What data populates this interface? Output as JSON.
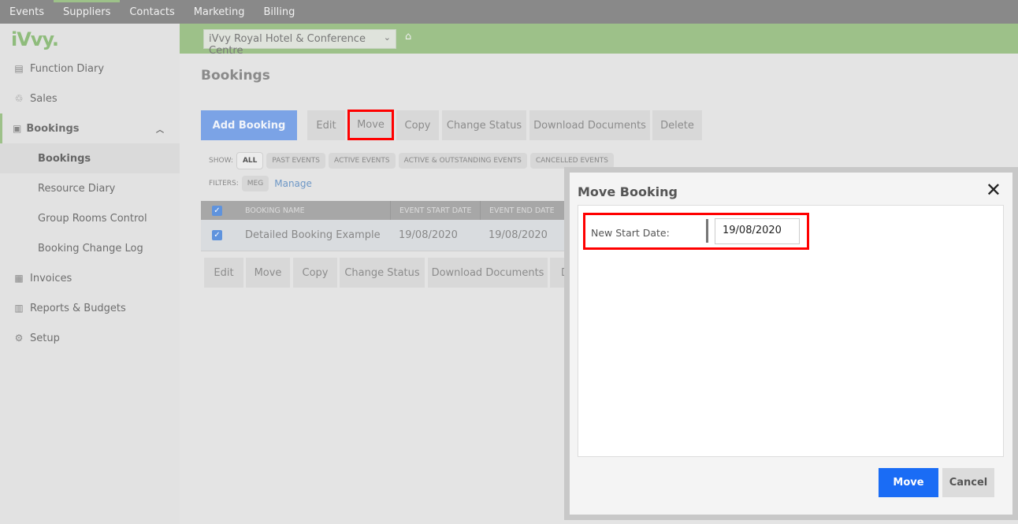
{
  "topnav": [
    "Events",
    "Suppliers",
    "Contacts",
    "Marketing",
    "Billing"
  ],
  "logo": "iVvy.",
  "sidebar": {
    "items": [
      {
        "icon": "calendar-icon",
        "label": "Function Diary"
      },
      {
        "icon": "sales-icon",
        "label": "Sales"
      },
      {
        "icon": "briefcase-icon",
        "label": "Bookings"
      },
      {
        "label": "Bookings"
      },
      {
        "label": "Resource Diary"
      },
      {
        "label": "Group Rooms Control"
      },
      {
        "label": "Booking Change Log"
      },
      {
        "icon": "calculator-icon",
        "label": "Invoices"
      },
      {
        "icon": "chart-icon",
        "label": "Reports & Budgets"
      },
      {
        "icon": "gear-icon",
        "label": "Setup"
      }
    ]
  },
  "venue": "iVvy Royal Hotel & Conference Centre",
  "page_title": "Bookings",
  "toolbar": {
    "add": "Add Booking",
    "edit": "Edit",
    "move": "Move",
    "copy": "Copy",
    "change_status": "Change Status",
    "download": "Download Documents",
    "delete": "Delete"
  },
  "show": {
    "label": "SHOW:",
    "options": [
      "ALL",
      "PAST EVENTS",
      "ACTIVE EVENTS",
      "ACTIVE & OUTSTANDING EVENTS",
      "CANCELLED EVENTS"
    ]
  },
  "filters": {
    "label": "FILTERS:",
    "chip": "MEG",
    "manage": "Manage"
  },
  "table": {
    "headers": [
      "BOOKING NAME",
      "EVENT START DATE",
      "EVENT END DATE"
    ],
    "rows": [
      {
        "name": "Detailed Booking Example",
        "start": "19/08/2020",
        "end": "19/08/2020"
      }
    ]
  },
  "bottom_toolbar": {
    "edit": "Edit",
    "move": "Move",
    "copy": "Copy",
    "change_status": "Change Status",
    "download": "Download Documents",
    "delete": "De"
  },
  "modal": {
    "title": "Move Booking",
    "field_label": "New Start Date:",
    "field_value": "19/08/2020",
    "move": "Move",
    "cancel": "Cancel"
  }
}
